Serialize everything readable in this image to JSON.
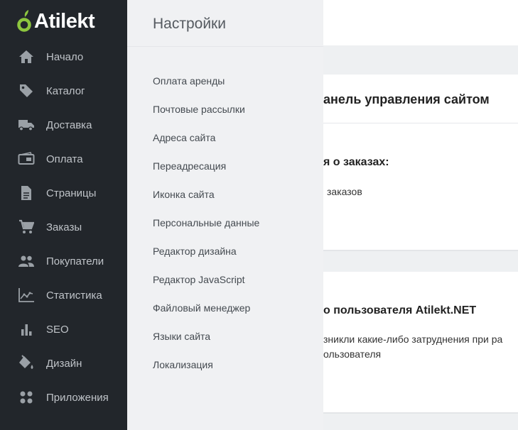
{
  "brand": {
    "name": "Atilekt",
    "accent": "#8dc63f"
  },
  "sidebar": {
    "items": [
      {
        "label": "Начало",
        "icon": "home-icon"
      },
      {
        "label": "Каталог",
        "icon": "tag-icon"
      },
      {
        "label": "Доставка",
        "icon": "truck-icon"
      },
      {
        "label": "Оплата",
        "icon": "wallet-icon"
      },
      {
        "label": "Страницы",
        "icon": "document-icon"
      },
      {
        "label": "Заказы",
        "icon": "cart-icon"
      },
      {
        "label": "Покупатели",
        "icon": "users-icon"
      },
      {
        "label": "Статистика",
        "icon": "chart-line-icon"
      },
      {
        "label": "SEO",
        "icon": "bar-chart-icon"
      },
      {
        "label": "Дизайн",
        "icon": "paint-bucket-icon"
      },
      {
        "label": "Приложения",
        "icon": "apps-icon"
      }
    ]
  },
  "settings": {
    "title": "Настройки",
    "items": [
      "Оплата аренды",
      "Почтовые рассылки",
      "Адреса сайта",
      "Переадресация",
      "Иконка сайта",
      "Персональные данные",
      "Редактор дизайна",
      "Редактор JavaScript",
      "Файловый менеджер",
      "Языки сайта",
      "Локализация"
    ]
  },
  "dashboard": {
    "card1": {
      "title": "анель управления сайтом",
      "subtitle": "я о заказах:",
      "text": "заказов"
    },
    "card2": {
      "title": "о пользователя Atilekt.NET",
      "line1": "зникли какие-либо затруднения при ра",
      "line2": "ользователя"
    }
  }
}
